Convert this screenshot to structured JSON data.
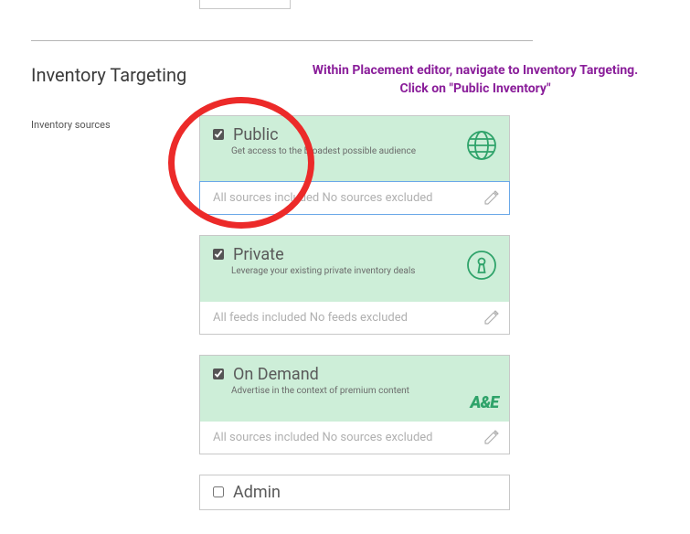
{
  "section_title": "Inventory Targeting",
  "annotation_line1": "Within Placement editor, navigate to Inventory Targeting.",
  "annotation_line2": "Click on \"Public Inventory\"",
  "side_label": "Inventory sources",
  "cards": {
    "public": {
      "title": "Public",
      "subtitle": "Get access to the broadest possible audience",
      "footer": "All sources included No sources excluded",
      "checked": true
    },
    "private": {
      "title": "Private",
      "subtitle": "Leverage your existing private inventory deals",
      "footer": "All feeds included No feeds excluded",
      "checked": true
    },
    "ondemand": {
      "title": "On Demand",
      "subtitle": "Advertise in the context of premium content",
      "footer": "All sources included No sources excluded",
      "checked": true,
      "badge": "A&E"
    },
    "admin": {
      "title": "Admin",
      "checked": false
    }
  }
}
